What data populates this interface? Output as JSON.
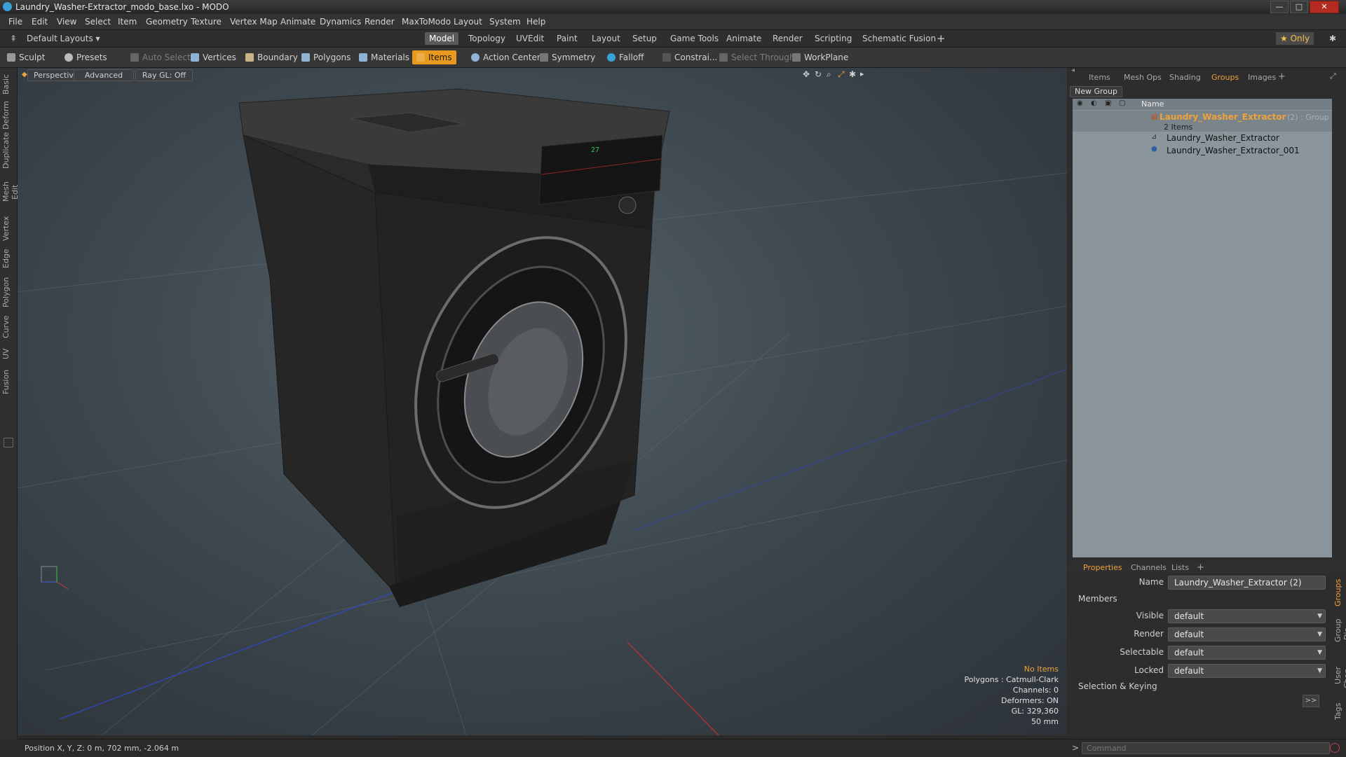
{
  "window": {
    "title": "Laundry_Washer-Extractor_modo_base.lxo - MODO",
    "minimize": "—",
    "maximize": "□",
    "close": "✕"
  },
  "menu": [
    "File",
    "Edit",
    "View",
    "Select",
    "Item",
    "Geometry",
    "Texture",
    "Vertex Map",
    "Animate",
    "Dynamics",
    "Render",
    "MaxToModo",
    "Layout",
    "System",
    "Help"
  ],
  "layout": {
    "selector": "Default Layouts ▾",
    "tabs": [
      "Model",
      "Topology",
      "UVEdit",
      "Paint",
      "Layout",
      "Setup",
      "Game Tools",
      "Animate",
      "Render",
      "Scripting",
      "Schematic Fusion"
    ],
    "active_tab": "Model",
    "add": "+",
    "only": "★  Only",
    "gear": "✱"
  },
  "toolbar": {
    "sculpt": "Sculpt",
    "presets": "Presets",
    "auto_select": "Auto Select",
    "vertices": "Vertices",
    "boundary": "Boundary",
    "polygons": "Polygons",
    "materials": "Materials",
    "items": "Items",
    "action_center": "Action Center",
    "symmetry": "Symmetry",
    "falloff": "Falloff",
    "constrain": "Constrai...",
    "select_through": "Select Through",
    "workplane": "WorkPlane"
  },
  "left_tabs": [
    "Basic",
    "Deform",
    "Duplicate",
    "Mesh Edit",
    "Vertex",
    "Edge",
    "Polygon",
    "Curve",
    "UV",
    "Fusion"
  ],
  "viewport": {
    "perspective": "Perspective",
    "advanced": "Advanced",
    "raygl": "Ray GL: Off",
    "panel_readout": "27",
    "stats": {
      "no_items": "No Items",
      "polygons": "Polygons : Catmull-Clark",
      "channels": "Channels: 0",
      "deformers": "Deformers: ON",
      "gl": "GL: 329,360",
      "focal": "50 mm"
    }
  },
  "panel_tabs": [
    "Items",
    "Mesh Ops",
    "Shading",
    "Groups",
    "Images"
  ],
  "panel_active": "Groups",
  "new_group": "New Group",
  "list_header": "Name",
  "group": {
    "name": "Laundry_Washer_Extractor",
    "suffix": "(2) : Group",
    "count": "2 Items",
    "children": [
      "Laundry_Washer_Extractor",
      "Laundry_Washer_Extractor_001"
    ]
  },
  "props_tabs": [
    "Properties",
    "Channels",
    "Lists"
  ],
  "props_active": "Properties",
  "properties": {
    "name_label": "Name",
    "name_value": "Laundry_Washer_Extractor (2)",
    "members": "Members",
    "rows": [
      {
        "label": "Visible",
        "value": "default"
      },
      {
        "label": "Render",
        "value": "default"
      },
      {
        "label": "Selectable",
        "value": "default"
      },
      {
        "label": "Locked",
        "value": "default"
      }
    ],
    "selection_keying": "Selection & Keying",
    "expand": ">>"
  },
  "side_tabs": [
    "Groups",
    "Group Dis...",
    "User Chan...",
    "Tags"
  ],
  "status": {
    "position": "Position X, Y, Z:  0 m, 702 mm, -2.064 m"
  },
  "command": {
    "prompt": ">",
    "placeholder": "Command"
  },
  "colors": {
    "accent": "#e89a1e",
    "group_highlight": "#f0a23a",
    "list_bg": "#8b959c"
  }
}
